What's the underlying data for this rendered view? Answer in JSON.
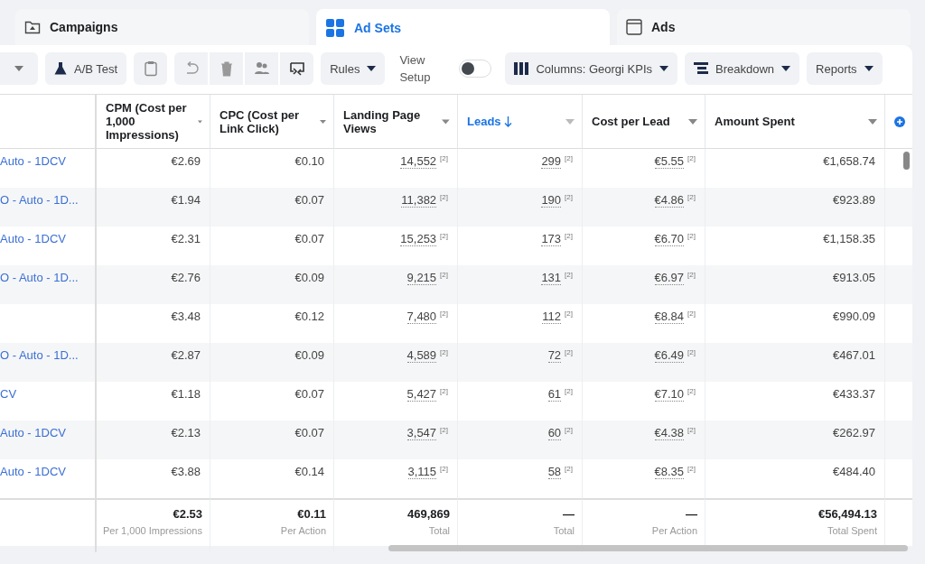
{
  "tabs": [
    {
      "label": "Campaigns",
      "selected": false
    },
    {
      "label": "Ad Sets",
      "selected": true
    },
    {
      "label": "Ads",
      "selected": false
    }
  ],
  "toolbar": [
    {
      "kind": "caret"
    },
    {
      "kind": "button",
      "label": "A/B Test"
    },
    {
      "kind": "icon"
    },
    {
      "kind": "icon"
    },
    {
      "kind": "icon"
    },
    {
      "kind": "icon"
    },
    {
      "kind": "icon"
    },
    {
      "kind": "menu",
      "label": "Rules"
    },
    {
      "kind": "toggle",
      "label": "View Setup",
      "on": false
    },
    {
      "kind": "menu",
      "label": "Columns: Georgi KPIs"
    },
    {
      "kind": "menu",
      "label": "Breakdown"
    },
    {
      "kind": "menu",
      "label": "Reports"
    }
  ],
  "table": {
    "columns": [
      {
        "label": "CPM (Cost per 1,000 Impressions)",
        "sorted": false
      },
      {
        "label": "CPC (Cost per Link Click)",
        "sorted": false
      },
      {
        "label": "Landing Page Views",
        "sorted": false
      },
      {
        "label": "Leads",
        "sorted": true
      },
      {
        "label": "Cost per Lead",
        "sorted": false
      },
      {
        "label": "Amount Spent",
        "sorted": false
      }
    ],
    "rows": [
      {
        "name": "Auto - 1DCV",
        "cells": [
          {
            "value": "€2.69"
          },
          {
            "value": "€0.10"
          },
          {
            "value": "14,552",
            "note": "[2]"
          },
          {
            "value": "299",
            "note": "[2]"
          },
          {
            "value": "€5.55",
            "note": "[2]"
          },
          {
            "value": "€1,658.74"
          }
        ]
      },
      {
        "name": "O - Auto - 1D...",
        "cells": [
          {
            "value": "€1.94"
          },
          {
            "value": "€0.07"
          },
          {
            "value": "11,382",
            "note": "[2]"
          },
          {
            "value": "190",
            "note": "[2]"
          },
          {
            "value": "€4.86",
            "note": "[2]"
          },
          {
            "value": "€923.89"
          }
        ]
      },
      {
        "name": "Auto - 1DCV",
        "cells": [
          {
            "value": "€2.31"
          },
          {
            "value": "€0.07"
          },
          {
            "value": "15,253",
            "note": "[2]"
          },
          {
            "value": "173",
            "note": "[2]"
          },
          {
            "value": "€6.70",
            "note": "[2]"
          },
          {
            "value": "€1,158.35"
          }
        ]
      },
      {
        "name": "O - Auto - 1D...",
        "cells": [
          {
            "value": "€2.76"
          },
          {
            "value": "€0.09"
          },
          {
            "value": "9,215",
            "note": "[2]"
          },
          {
            "value": "131",
            "note": "[2]"
          },
          {
            "value": "€6.97",
            "note": "[2]"
          },
          {
            "value": "€913.05"
          }
        ]
      },
      {
        "cells": [
          {
            "value": "€3.48"
          },
          {
            "value": "€0.12"
          },
          {
            "value": "7,480",
            "note": "[2]"
          },
          {
            "value": "112",
            "note": "[2]"
          },
          {
            "value": "€8.84",
            "note": "[2]"
          },
          {
            "value": "€990.09"
          }
        ]
      },
      {
        "name": "O - Auto - 1D...",
        "cells": [
          {
            "value": "€2.87"
          },
          {
            "value": "€0.09"
          },
          {
            "value": "4,589",
            "note": "[2]"
          },
          {
            "value": "72",
            "note": "[2]"
          },
          {
            "value": "€6.49",
            "note": "[2]"
          },
          {
            "value": "€467.01"
          }
        ]
      },
      {
        "name": "CV",
        "cells": [
          {
            "value": "€1.18"
          },
          {
            "value": "€0.07"
          },
          {
            "value": "5,427",
            "note": "[2]"
          },
          {
            "value": "61",
            "note": "[2]"
          },
          {
            "value": "€7.10",
            "note": "[2]"
          },
          {
            "value": "€433.37"
          }
        ]
      },
      {
        "name": "Auto - 1DCV",
        "cells": [
          {
            "value": "€2.13"
          },
          {
            "value": "€0.07"
          },
          {
            "value": "3,547",
            "note": "[2]"
          },
          {
            "value": "60",
            "note": "[2]"
          },
          {
            "value": "€4.38",
            "note": "[2]"
          },
          {
            "value": "€262.97"
          }
        ]
      },
      {
        "name": "Auto - 1DCV",
        "cells": [
          {
            "value": "€3.88"
          },
          {
            "value": "€0.14"
          },
          {
            "value": "3,115",
            "note": "[2]"
          },
          {
            "value": "58",
            "note": "[2]"
          },
          {
            "value": "€8.35",
            "note": "[2]"
          },
          {
            "value": "€484.40"
          }
        ]
      }
    ],
    "footer": [
      {
        "value": "€2.53",
        "caption": "Per 1,000 Impressions"
      },
      {
        "value": "€0.11",
        "caption": "Per Action"
      },
      {
        "value": "469,869",
        "caption": "Total"
      },
      {
        "value": "—",
        "caption": "Total"
      },
      {
        "value": "—",
        "caption": "Per Action"
      },
      {
        "value": "€56,494.13",
        "caption": "Total Spent"
      }
    ]
  }
}
